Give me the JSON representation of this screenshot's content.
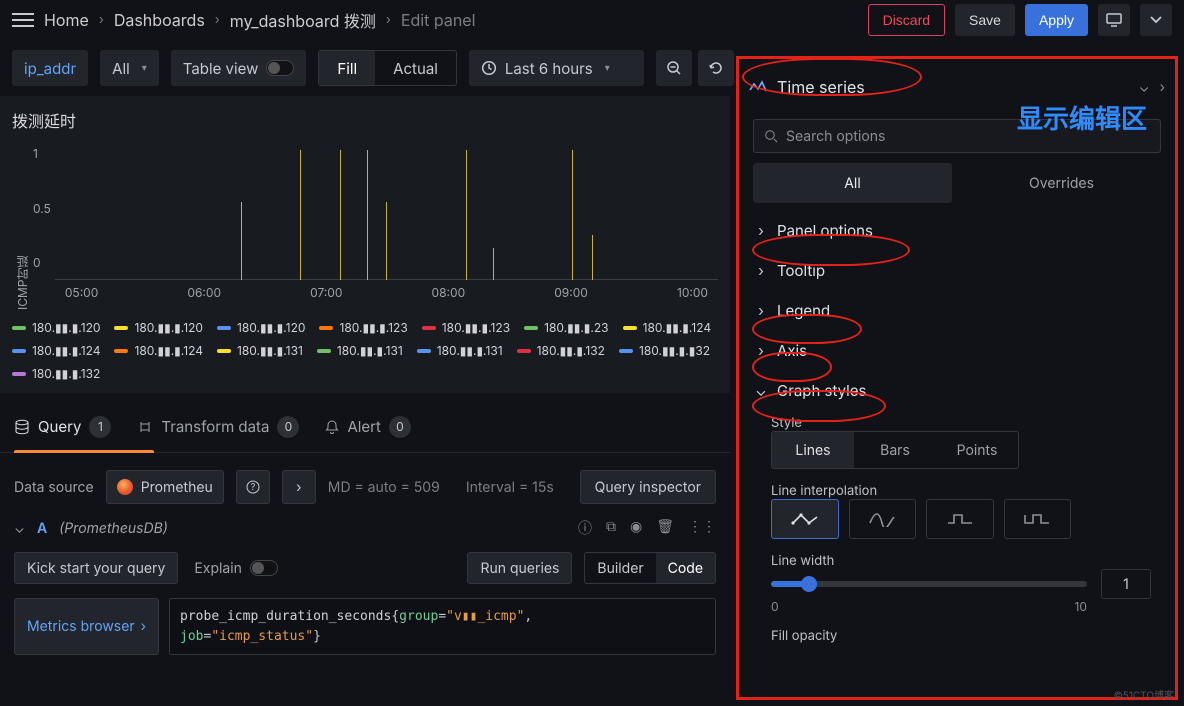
{
  "breadcrumb": {
    "home": "Home",
    "dashboards": "Dashboards",
    "dashboard_name": "my_dashboard 拨测",
    "edit": "Edit panel"
  },
  "actions": {
    "discard": "Discard",
    "save": "Save",
    "apply": "Apply"
  },
  "toolbar": {
    "ip_var": "ip_addr",
    "ip_all": "All",
    "table_view": "Table view",
    "fill": "Fill",
    "actual": "Actual",
    "time_range": "Last 6 hours"
  },
  "panel": {
    "title": "拨测延时",
    "y_label": "ICMP时延"
  },
  "chart_data": {
    "type": "line",
    "title": "拨测延时",
    "ylabel": "ICMP时延",
    "ylim": [
      0,
      1
    ],
    "yticks": [
      0,
      0.5,
      1
    ],
    "xticks": [
      "05:00",
      "06:00",
      "07:00",
      "08:00",
      "09:00",
      "10:00"
    ],
    "spikes_pct_x": [
      28,
      37,
      43,
      47,
      50,
      62,
      66,
      78,
      81
    ],
    "spikes_height": [
      0.6,
      1,
      1,
      1,
      0.6,
      1,
      0.25,
      1,
      0.35
    ],
    "legend_items": [
      {
        "label": "180.▮▮.▮.120",
        "color": "#73bf69"
      },
      {
        "label": "180.▮▮.▮.120",
        "color": "#fade2a"
      },
      {
        "label": "180.▮▮.▮.120",
        "color": "#5794f2"
      },
      {
        "label": "180.▮▮.▮.123",
        "color": "#ff780a"
      },
      {
        "label": "180.▮▮.▮.123",
        "color": "#e02f44"
      },
      {
        "label": "180.▮▮.▮.23",
        "color": "#73bf69"
      },
      {
        "label": "180.▮▮.▮.124",
        "color": "#fade2a"
      },
      {
        "label": "180.▮▮.▮.124",
        "color": "#5794f2"
      },
      {
        "label": "180.▮▮.▮.124",
        "color": "#ff780a"
      },
      {
        "label": "180.▮▮.▮.131",
        "color": "#fade2a"
      },
      {
        "label": "180.▮▮.▮.131",
        "color": "#73bf69"
      },
      {
        "label": "180.▮▮.▮.131",
        "color": "#5794f2"
      },
      {
        "label": "180.▮▮.▮.132",
        "color": "#e02f44"
      },
      {
        "label": "180.▮▮.▮.▮32",
        "color": "#5794f2"
      },
      {
        "label": "180.▮▮.▮.132",
        "color": "#b877d9"
      }
    ]
  },
  "tabs": {
    "query": "Query",
    "query_count": "1",
    "transform": "Transform data",
    "transform_count": "0",
    "alert": "Alert",
    "alert_count": "0"
  },
  "datasource": {
    "label": "Data source",
    "name": "Prometheu",
    "md_txt": "MD = auto = 509",
    "interval_txt": "Interval = 15s",
    "qi": "Query inspector"
  },
  "query_a": {
    "ds_name": "(PrometheusDB)",
    "kick": "Kick start your query",
    "explain": "Explain",
    "run": "Run queries",
    "builder": "Builder",
    "code": "Code",
    "metrics_browser": "Metrics browser",
    "expr_metric": "probe_icmp_duration_seconds",
    "expr_k1": "group",
    "expr_v1": "v▮▮_icmp",
    "expr_k2": "job",
    "expr_v2": "icmp_status"
  },
  "right": {
    "vis_name": "Time series",
    "edit_area": "显示编辑区",
    "search_placeholder": "Search options",
    "tab_all": "All",
    "tab_overrides": "Overrides",
    "sec_panel": "Panel options",
    "sec_tooltip": "Tooltip",
    "sec_legend": "Legend",
    "sec_axis": "Axis",
    "sec_graph": "Graph styles",
    "style_label": "Style",
    "style_lines": "Lines",
    "style_bars": "Bars",
    "style_points": "Points",
    "interp_label": "Line interpolation",
    "lw_label": "Line width",
    "lw_value": "1",
    "lw_min": "0",
    "lw_max": "10",
    "fo_label": "Fill opacity"
  },
  "watermark": "©51CTO博客"
}
